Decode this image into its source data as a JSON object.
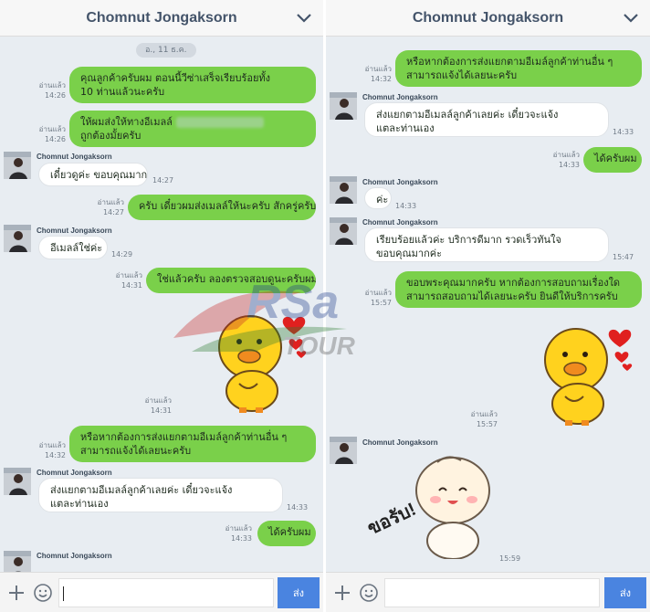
{
  "contact_name": "Chomnut Jongaksorn",
  "date_chip": "อ., 11 ธ.ค.",
  "read_label": "อ่านแล้ว",
  "send_label": "ส่ง",
  "sticker_text": "ขอรับ!",
  "watermark": {
    "main": "RSa",
    "sub": "TOUR"
  },
  "left": {
    "m1": {
      "line1": "คุณลูกค้าครับผม ตอนนี้วีซ่าเสร็จเรียบร้อยทั้ง",
      "line2": "10 ท่านแล้วนะครับ",
      "time": "14:26"
    },
    "m2": {
      "line1": "ให้ผมส่งให้ทางอีเมลล์",
      "line2": "ถูกต้องมั้ยครับ",
      "time": "14:26"
    },
    "m3": {
      "text": "เดี๋ยวดูค่ะ ขอบคุณมาก",
      "time": "14:27"
    },
    "m4": {
      "text": "ครับ เดี๋ยวผมส่งเมลล์ให้นะครับ สักครู่ครับ",
      "time": "14:27"
    },
    "m5": {
      "text": "อีเมลล์ใช่ค่ะ",
      "time": "14:29"
    },
    "m6": {
      "text": "ใช่แล้วครับ ลองตรวจสอบดูนะครับผม",
      "time": "14:31"
    },
    "m7": {
      "time": "14:31"
    },
    "m8": {
      "line1": "หรือหากต้องการส่งแยกตามอีเมล์ลูกค้าท่านอื่น ๆ",
      "line2": "สามารถแจ้งได้เลยนะครับ",
      "time": "14:32"
    },
    "m9": {
      "line1": "ส่งแยกตามอีเมลล์ลูกค้าเลยค่ะ เดี๋ยวจะแจ้ง",
      "line2": "แตละท่านเอง",
      "time": "14:33"
    },
    "m10": {
      "text": "ได้ครับผม",
      "time": "14:33"
    }
  },
  "right": {
    "m1": {
      "line1": "หรือหากต้องการส่งแยกตามอีเมล์ลูกค้าท่านอื่น ๆ",
      "line2": "สามารถแจ้งได้เลยนะครับ",
      "time": "14:32"
    },
    "m2": {
      "line1": "ส่งแยกตามอีเมลล์ลูกค้าเลยค่ะ เดี๋ยวจะแจ้ง",
      "line2": "แตละท่านเอง",
      "time": "14:33"
    },
    "m3": {
      "text": "ได้ครับผม",
      "time": "14:33"
    },
    "m4": {
      "text": "ค่ะ",
      "time": "14:33"
    },
    "m5": {
      "line1": "เรียบร้อยแล้วค่ะ บริการดีมาก รวดเร็วทันใจ",
      "line2": "ขอบคุณมากค่ะ",
      "time": "15:47"
    },
    "m6": {
      "line1": "ขอบพระคุณมากครับ หากต้องการสอบถามเรื่องใด",
      "line2": "สามารถสอบถามได้เลยนะครับ ยินดีให้บริการครับ",
      "time": "15:57"
    },
    "m7": {
      "time": "15:57"
    },
    "m8": {
      "time": "15:59"
    }
  }
}
